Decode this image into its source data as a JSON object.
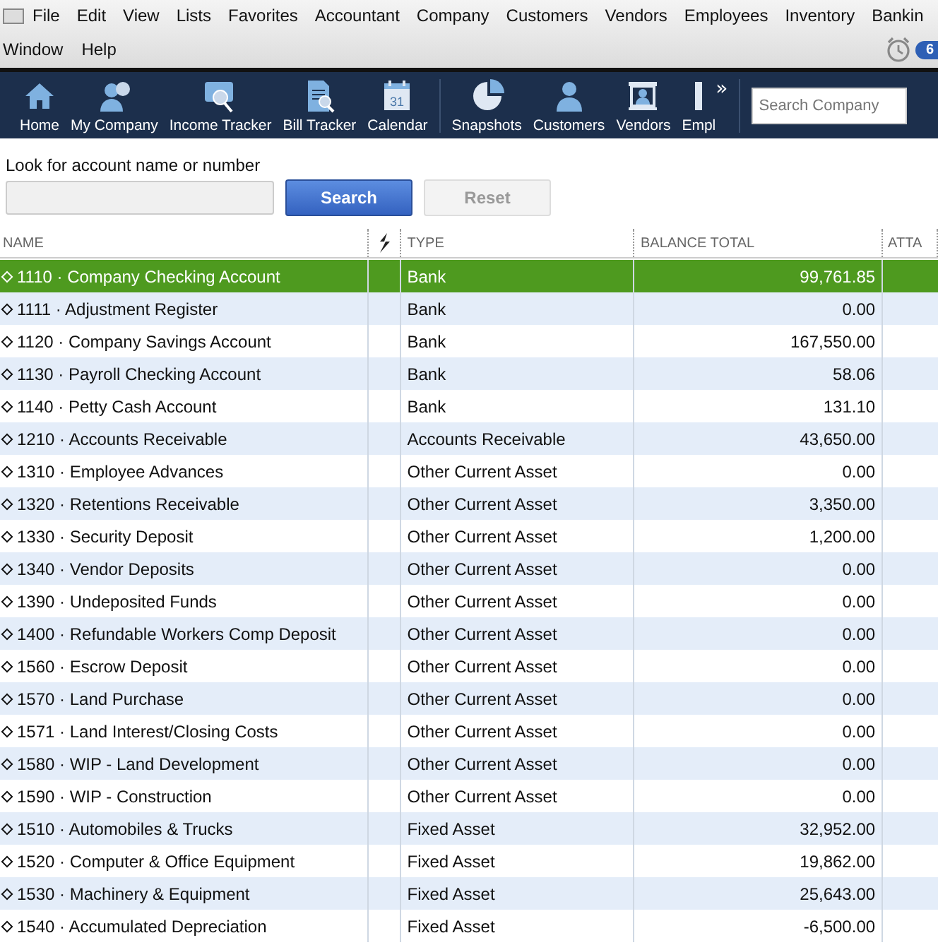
{
  "menu_bar": {
    "row_1": [
      "File",
      "Edit",
      "View",
      "Lists",
      "Favorites",
      "Accountant",
      "Company",
      "Customers",
      "Vendors",
      "Employees",
      "Inventory",
      "Bankin"
    ],
    "row_2": [
      "Window",
      "Help"
    ],
    "reminder_count": "6"
  },
  "toolbar": {
    "items": [
      {
        "label": "Home",
        "kind": "home"
      },
      {
        "label": "My Company",
        "kind": "company"
      },
      {
        "label": "Income Tracker",
        "kind": "income"
      },
      {
        "label": "Bill Tracker",
        "kind": "bill"
      },
      {
        "label": "Calendar",
        "kind": "calendar",
        "icon_text": "31"
      },
      {
        "label": "Snapshots",
        "kind": "pie"
      },
      {
        "label": "Customers",
        "kind": "person"
      },
      {
        "label": "Vendors",
        "kind": "vendor"
      },
      {
        "label": "Empl",
        "kind": "bar"
      }
    ],
    "more": "»",
    "search": {
      "placeholder": "Search Company"
    }
  },
  "search": {
    "label": "Look for account name or number",
    "buttons": [
      {
        "label": "Search",
        "disabled": false
      },
      {
        "label": "Reset",
        "disabled": true
      }
    ]
  },
  "table": {
    "columns": [
      "NAME",
      "TYPE",
      "BALANCE TOTAL",
      "ATTA"
    ],
    "rows": [
      {
        "name": "1110 · Company Checking Account",
        "type": "Bank",
        "balance": "99,761.85",
        "selected": true
      },
      {
        "name": "1111 · Adjustment Register",
        "type": "Bank",
        "balance": "0.00",
        "selected": false
      },
      {
        "name": "1120 · Company Savings Account",
        "type": "Bank",
        "balance": "167,550.00",
        "selected": false
      },
      {
        "name": "1130 · Payroll Checking Account",
        "type": "Bank",
        "balance": "58.06",
        "selected": false
      },
      {
        "name": "1140 · Petty Cash Account",
        "type": "Bank",
        "balance": "131.10",
        "selected": false
      },
      {
        "name": "1210 · Accounts Receivable",
        "type": "Accounts Receivable",
        "balance": "43,650.00",
        "selected": false
      },
      {
        "name": "1310 · Employee Advances",
        "type": "Other Current Asset",
        "balance": "0.00",
        "selected": false
      },
      {
        "name": "1320 · Retentions Receivable",
        "type": "Other Current Asset",
        "balance": "3,350.00",
        "selected": false
      },
      {
        "name": "1330 · Security Deposit",
        "type": "Other Current Asset",
        "balance": "1,200.00",
        "selected": false
      },
      {
        "name": "1340 · Vendor Deposits",
        "type": "Other Current Asset",
        "balance": "0.00",
        "selected": false
      },
      {
        "name": "1390 · Undeposited Funds",
        "type": "Other Current Asset",
        "balance": "0.00",
        "selected": false
      },
      {
        "name": "1400 · Refundable Workers Comp Deposit",
        "type": "Other Current Asset",
        "balance": "0.00",
        "selected": false
      },
      {
        "name": "1560 · Escrow Deposit",
        "type": "Other Current Asset",
        "balance": "0.00",
        "selected": false
      },
      {
        "name": "1570 · Land Purchase",
        "type": "Other Current Asset",
        "balance": "0.00",
        "selected": false
      },
      {
        "name": "1571 · Land Interest/Closing Costs",
        "type": "Other Current Asset",
        "balance": "0.00",
        "selected": false
      },
      {
        "name": "1580 · WIP - Land Development",
        "type": "Other Current Asset",
        "balance": "0.00",
        "selected": false
      },
      {
        "name": "1590 · WIP - Construction",
        "type": "Other Current Asset",
        "balance": "0.00",
        "selected": false
      },
      {
        "name": "1510 · Automobiles & Trucks",
        "type": "Fixed Asset",
        "balance": "32,952.00",
        "selected": false
      },
      {
        "name": "1520 · Computer & Office Equipment",
        "type": "Fixed Asset",
        "balance": "19,862.00",
        "selected": false
      },
      {
        "name": "1530 · Machinery & Equipment",
        "type": "Fixed Asset",
        "balance": "25,643.00",
        "selected": false
      },
      {
        "name": "1540 · Accumulated Depreciation",
        "type": "Fixed Asset",
        "balance": "-6,500.00",
        "selected": false
      }
    ]
  }
}
